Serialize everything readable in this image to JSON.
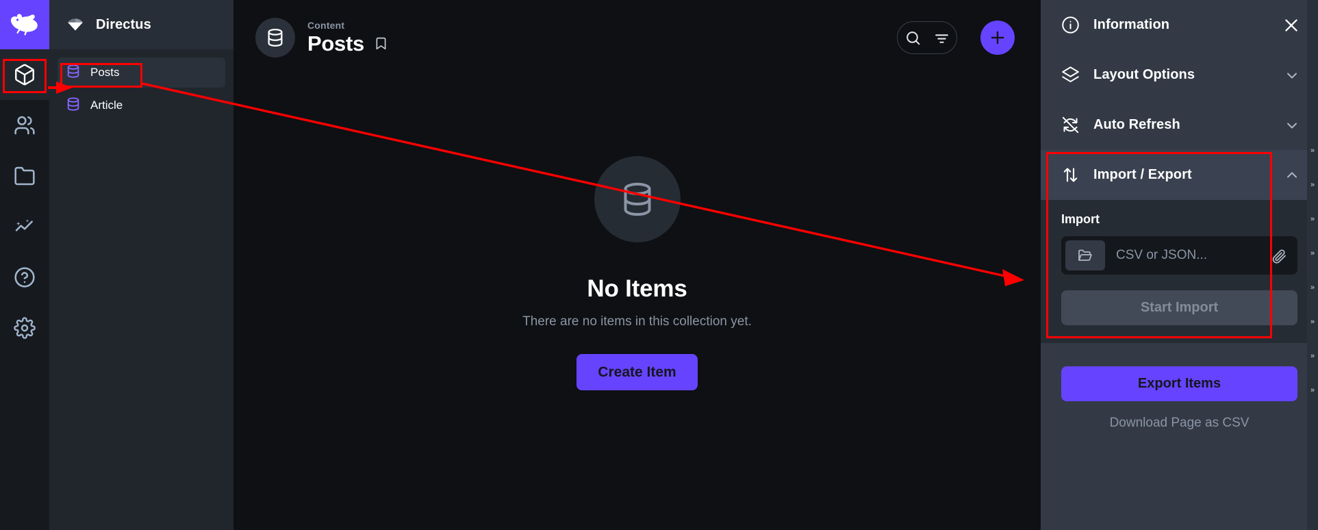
{
  "app": {
    "brand_logo_icon": "directus-rabbit-logo",
    "accent_color": "#6644ff",
    "annotation_color": "#ff0000"
  },
  "module_bar": {
    "items": [
      {
        "name": "content",
        "icon": "box-icon",
        "active": true
      },
      {
        "name": "user-directory",
        "icon": "people-icon",
        "active": false
      },
      {
        "name": "file-library",
        "icon": "folder-icon",
        "active": false
      },
      {
        "name": "insights",
        "icon": "trending-up-icon",
        "active": false
      },
      {
        "name": "docs",
        "icon": "question-circle-icon",
        "active": false
      },
      {
        "name": "settings",
        "icon": "gear-icon",
        "active": false
      }
    ]
  },
  "nav": {
    "title": "Directus",
    "title_icon": "directus-wordmark-icon",
    "collections": [
      {
        "label": "Posts",
        "icon": "database-icon",
        "selected": true
      },
      {
        "label": "Article",
        "icon": "database-icon",
        "selected": false
      }
    ]
  },
  "header": {
    "breadcrumb": "Content",
    "title": "Posts",
    "bookmark_icon": "bookmark-icon",
    "collection_icon": "database-icon",
    "search_icon": "search-icon",
    "filter_icon": "filter-icon",
    "add_icon": "plus-icon"
  },
  "empty_state": {
    "icon": "database-icon",
    "title": "No Items",
    "subtitle": "There are no items in this collection yet.",
    "button_label": "Create Item"
  },
  "drawer": {
    "sections": [
      {
        "label": "Information",
        "icon": "info-circle-icon",
        "trailing_icon": "close-icon",
        "state": "closed"
      },
      {
        "label": "Layout Options",
        "icon": "layers-icon",
        "trailing_icon": "chevron-down-icon",
        "state": "collapsed"
      },
      {
        "label": "Auto Refresh",
        "icon": "refresh-off-icon",
        "trailing_icon": "chevron-down-icon",
        "state": "collapsed"
      },
      {
        "label": "Import / Export",
        "icon": "import-export-icon",
        "trailing_icon": "chevron-up-icon",
        "state": "expanded"
      }
    ],
    "import": {
      "section_label": "Import",
      "browse_icon": "folder-open-icon",
      "file_placeholder": "CSV or JSON...",
      "file_value": "",
      "attach_icon": "paperclip-icon",
      "start_import_label": "Start Import",
      "start_import_disabled": true
    },
    "export": {
      "export_items_label": "Export Items",
      "download_link_label": "Download Page as CSV"
    },
    "edge_ticks": [
      "»",
      "»",
      "»",
      "»",
      "»",
      "»",
      "»",
      "»"
    ]
  }
}
